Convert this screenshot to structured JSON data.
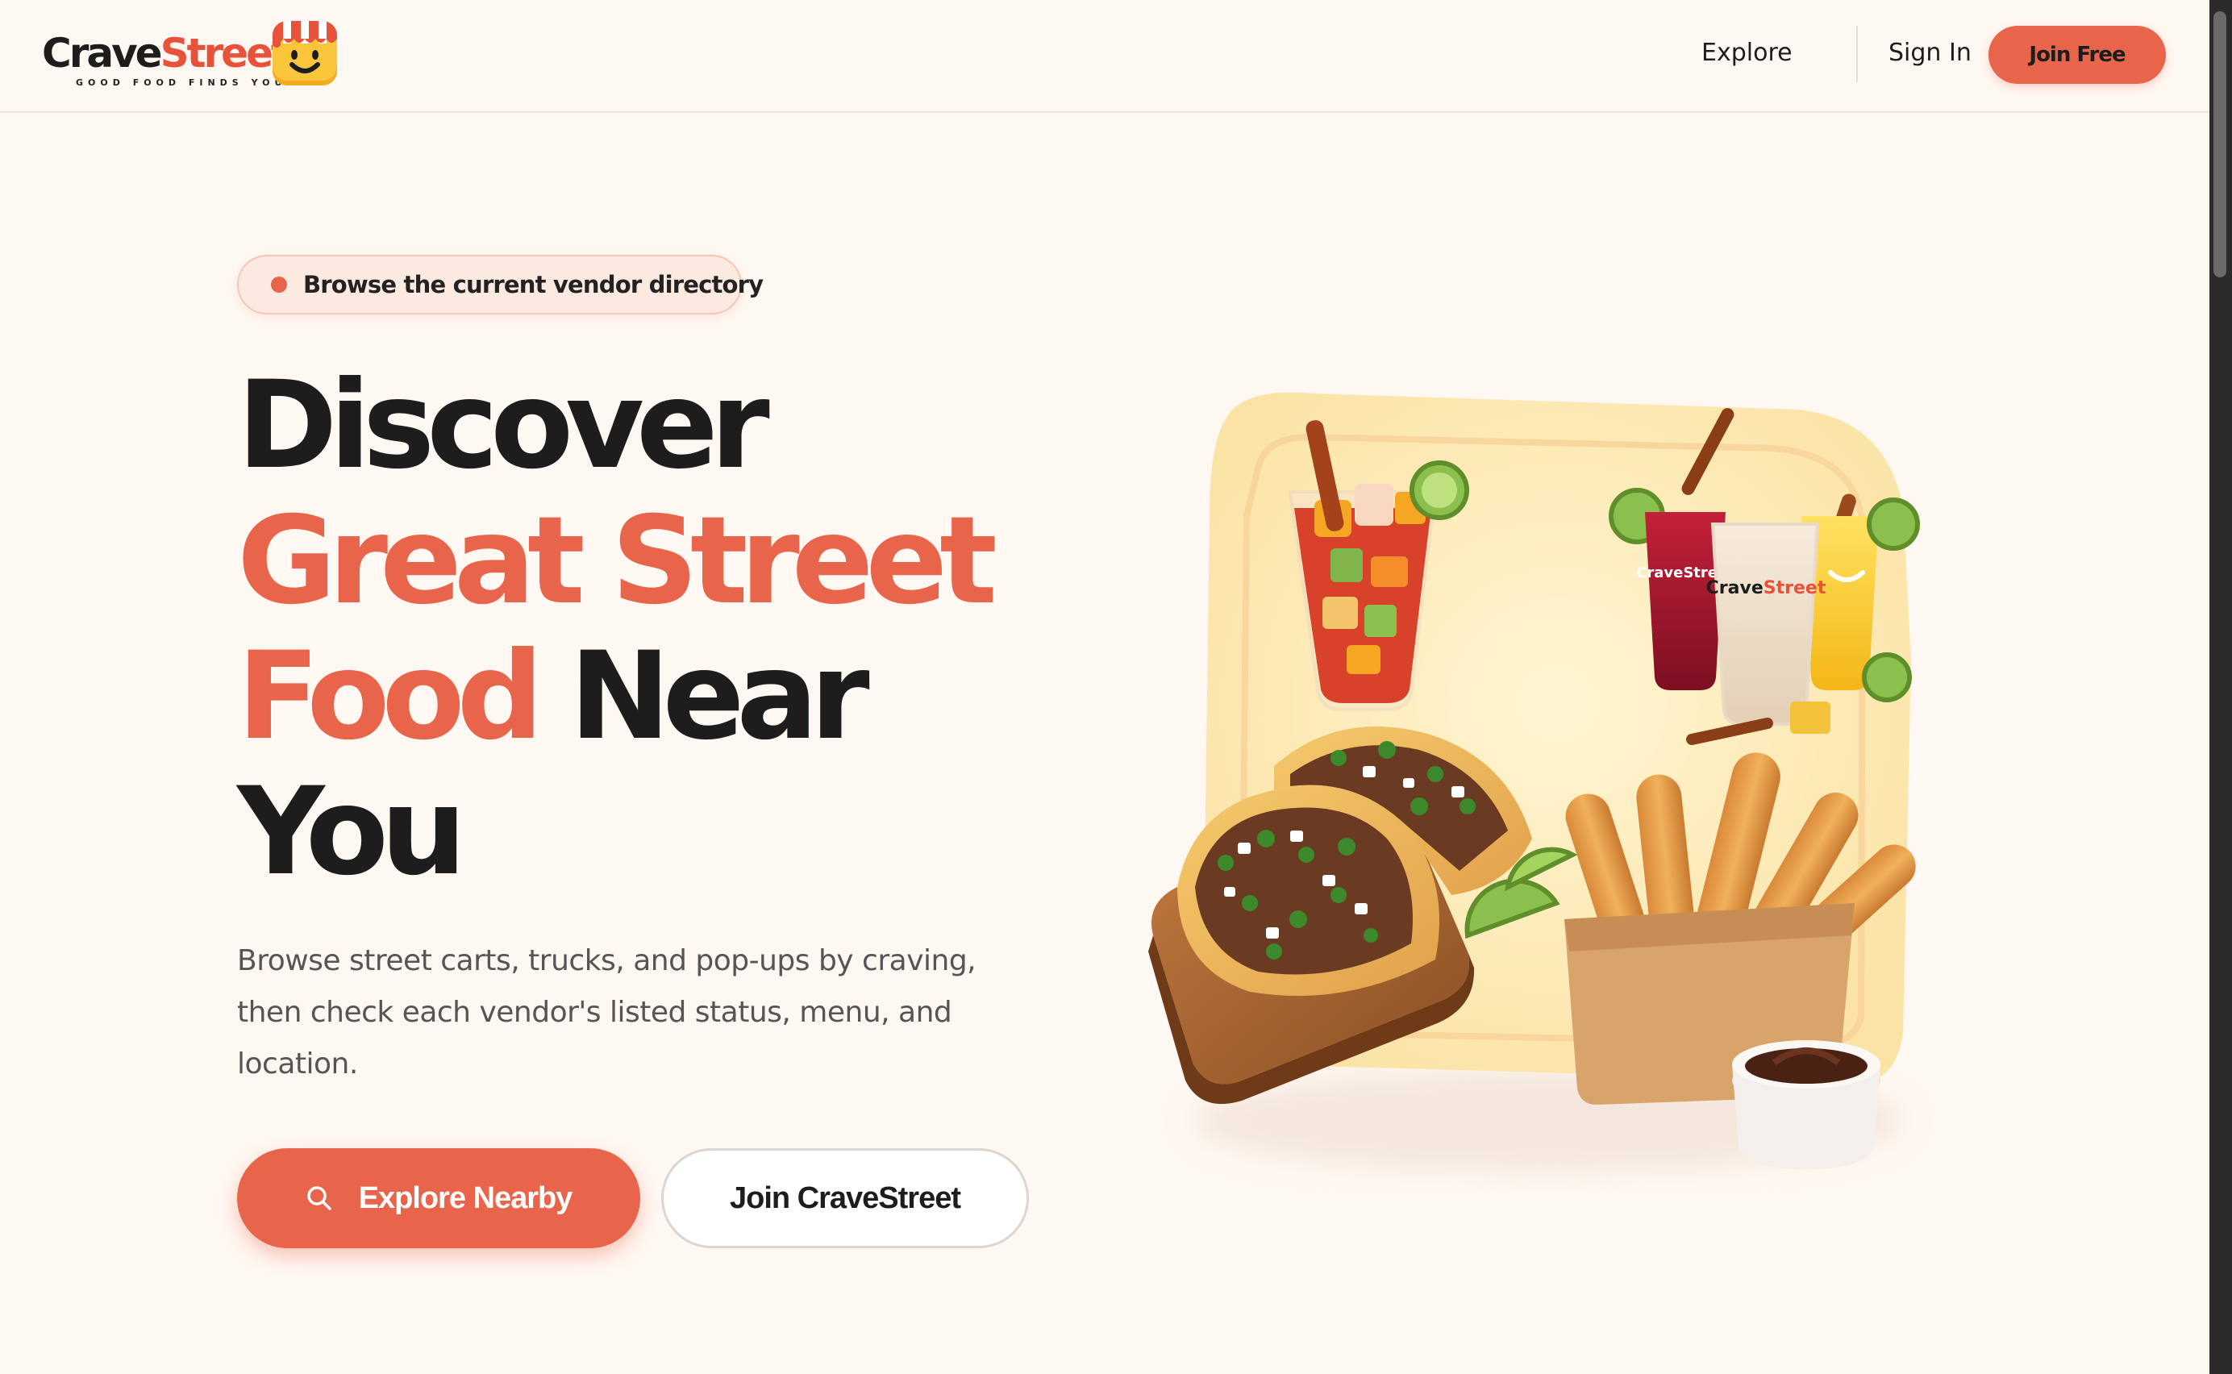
{
  "nav": {
    "logo": {
      "word_part1": "Crave",
      "word_part2": "Street",
      "tagline": "GOOD FOOD FINDS YOU"
    },
    "explore": "Explore",
    "sign_in": "Sign In",
    "join": "Join Free"
  },
  "hero": {
    "badge": "Browse the current vendor directory",
    "headline": {
      "line1": "Discover",
      "line2": "Great Street",
      "line3_accent": "Food",
      "line3_rest": "Near",
      "line4": "You"
    },
    "subtext": "Browse street carts, trucks, and pop-ups by craving, then check each vendor's listed status, menu, and location.",
    "primary_button": "Explore Nearby",
    "secondary_button": "Join CraveStreet"
  },
  "hero_art": {
    "cup_label_1": "CraveStreet",
    "cup_label_2_part1": "Crave",
    "cup_label_2_part2": "Street"
  },
  "colors": {
    "accent": "#e8644a",
    "background": "#fff7f1",
    "text": "#1d1d1d",
    "mascot": "#f9c53a"
  },
  "icons": [
    "search-icon",
    "mascot-logo-icon"
  ]
}
